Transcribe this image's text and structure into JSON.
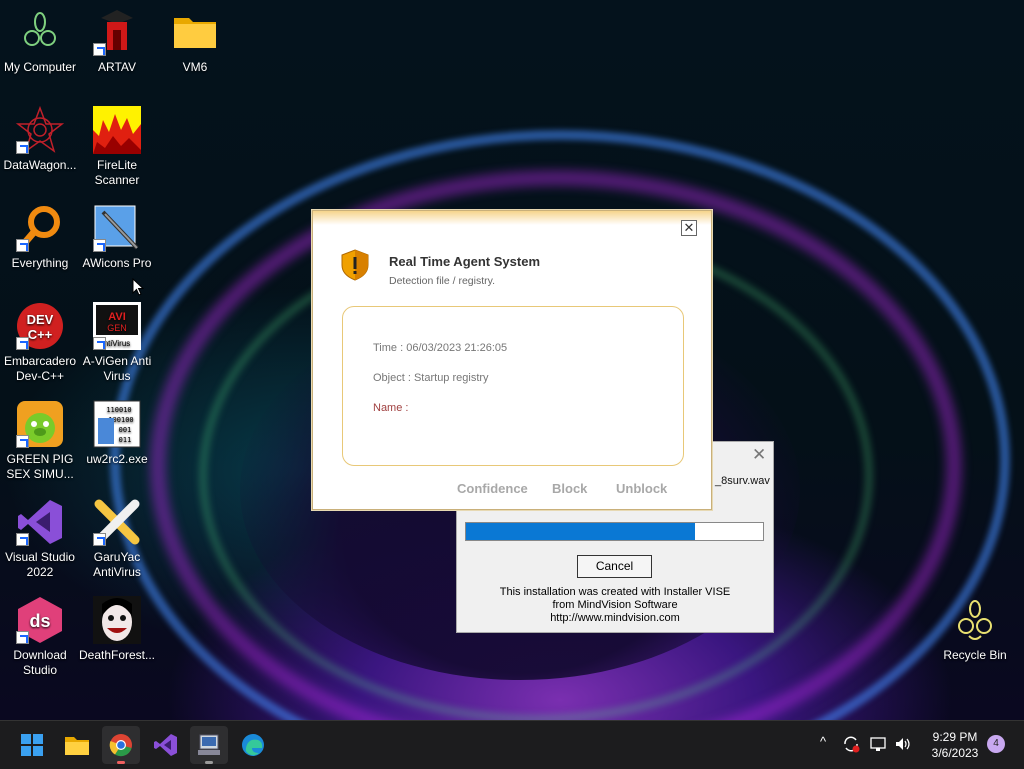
{
  "desktop_icons": [
    {
      "label": "My Computer",
      "icon": "my-computer-icon"
    },
    {
      "label": "ARTAV",
      "icon": "artav-icon"
    },
    {
      "label": "VM6",
      "icon": "folder-icon"
    },
    {
      "label": "DataWagon...",
      "icon": "datawagon-icon"
    },
    {
      "label": "FireLite Scanner",
      "icon": "firelite-icon"
    },
    {
      "label": "Everything",
      "icon": "everything-icon"
    },
    {
      "label": "AWicons Pro",
      "icon": "awicons-icon"
    },
    {
      "label": "Embarcadero Dev-C++",
      "icon": "devcpp-icon",
      "text": "DEV C++"
    },
    {
      "label": "A-ViGen Anti Virus",
      "icon": "avigen-icon",
      "text": "AVI GEN"
    },
    {
      "label": "GREEN PIG SEX SIMU...",
      "icon": "green-pig-icon"
    },
    {
      "label": "uw2rc2.exe",
      "icon": "uw2rc2-icon",
      "text": "110010 100100 001 011"
    },
    {
      "label": "Visual Studio 2022",
      "icon": "visual-studio-icon"
    },
    {
      "label": "GaruYac AntiVirus",
      "icon": "garuyac-icon"
    },
    {
      "label": "Download Studio",
      "icon": "download-studio-icon",
      "text": "ds"
    },
    {
      "label": "DeathForest...",
      "icon": "deathforest-icon"
    },
    {
      "label": "Recycle Bin",
      "icon": "recycle-bin-icon"
    }
  ],
  "alert_dialog": {
    "title": "Real Time Agent System",
    "subtitle": "Detection file / registry.",
    "close_glyph": "✕",
    "time": "Time : 06/03/2023  21:26:05",
    "object": "Object : Startup registry",
    "name": "Name :",
    "buttons": {
      "confidence": "Confidence",
      "block": "Block",
      "unblock": "Unblock"
    }
  },
  "installer_dialog": {
    "close_glyph": "✕",
    "filename": "_8surv.wav",
    "progress": 0.77,
    "cancel_label": "Cancel",
    "info_line1": "This installation was created with Installer VISE",
    "info_line2": "from MindVision Software",
    "info_line3": "http://www.mindvision.com",
    "accent": "#0a78d4"
  },
  "taskbar": {
    "apps": [
      "start-button",
      "file-explorer",
      "chrome",
      "visual-studio",
      "installer",
      "edge"
    ],
    "tray_chevron": "^",
    "time": "9:29 PM",
    "date": "3/6/2023",
    "notification_count": "4"
  }
}
